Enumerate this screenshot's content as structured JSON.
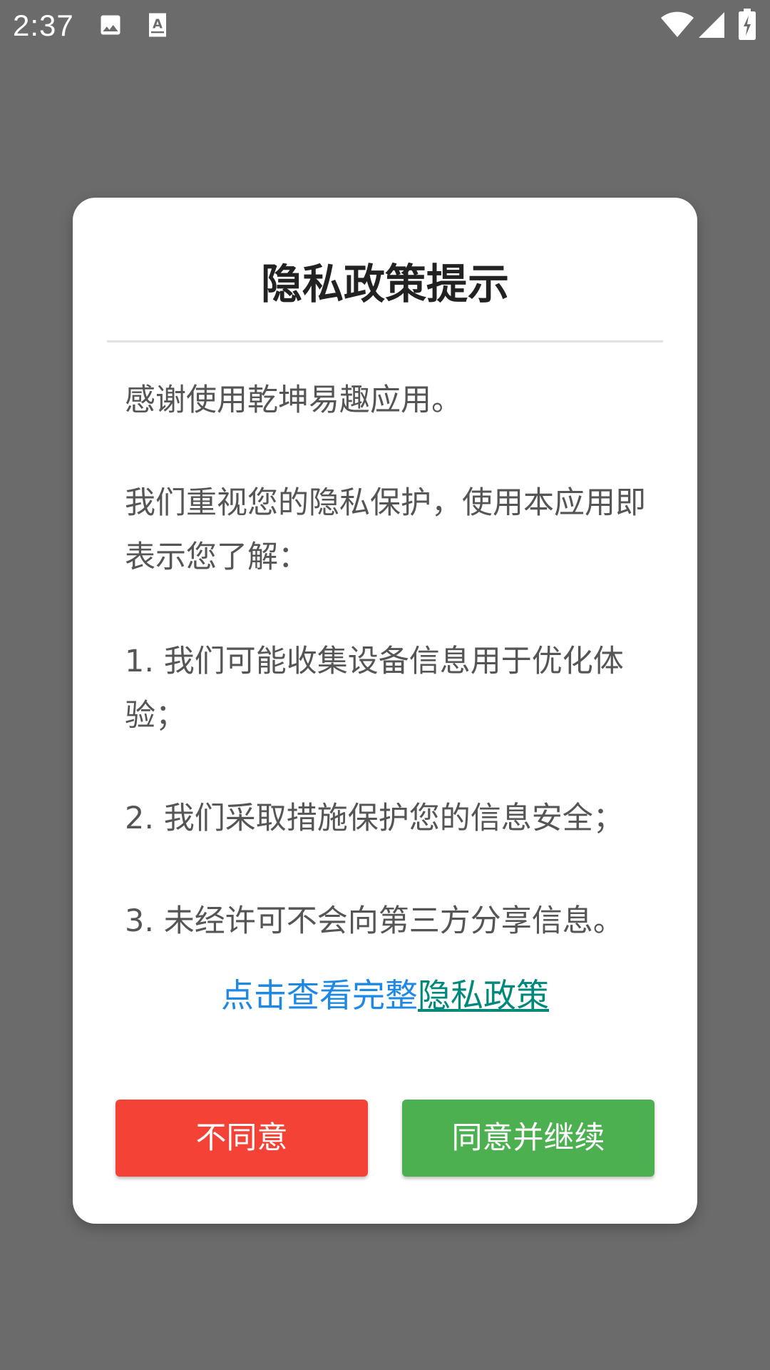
{
  "status_bar": {
    "time": "2:37",
    "icons": [
      "image-icon",
      "text-icon",
      "wifi-icon",
      "signal-icon",
      "battery-charging-icon"
    ]
  },
  "dialog": {
    "title": "隐私政策提示",
    "paragraphs": [
      "感谢使用乾坤易趣应用。",
      "我们重视您的隐私保护，使用本应用即表示您了解：",
      "1. 我们可能收集设备信息用于优化体验；",
      "2. 我们采取措施保护您的信息安全；",
      "3. 未经许可不会向第三方分享信息。"
    ],
    "link_lead": "点击查看完整",
    "link_policy": "隐私政策",
    "disagree_label": "不同意",
    "agree_label": "同意并继续"
  },
  "colors": {
    "overlay": "#6b6b6b",
    "disagree": "#f44336",
    "agree": "#4caf50",
    "link": "#1e88e5",
    "policy_link": "#00897b"
  }
}
